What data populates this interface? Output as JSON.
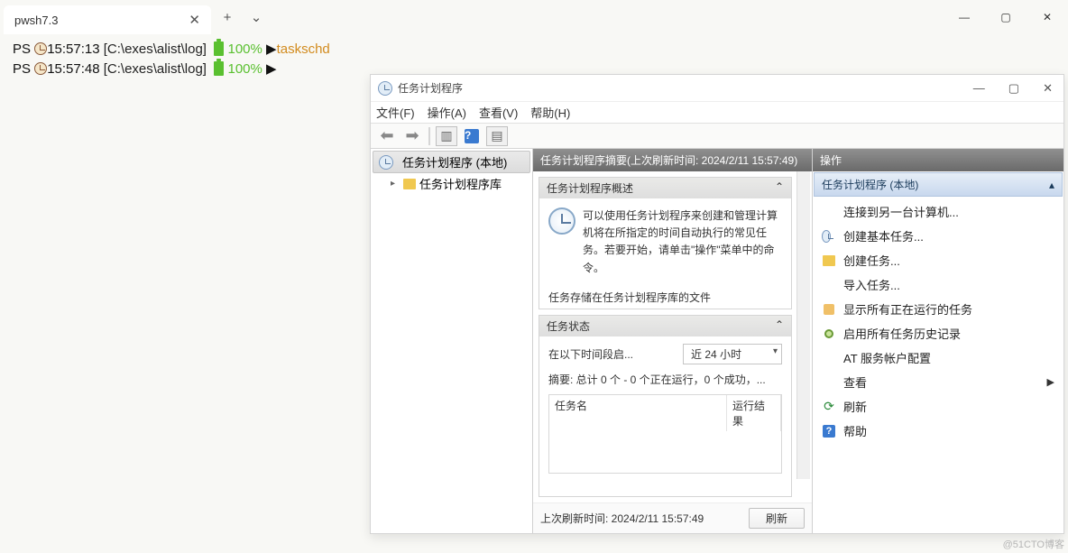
{
  "tab": {
    "title": "pwsh7.3"
  },
  "terminal": {
    "lines": [
      {
        "ps": "PS",
        "time": "15:57:13",
        "path": "[C:\\exes\\alist\\log]",
        "batt": "100%",
        "cmd": "taskschd"
      },
      {
        "ps": "PS",
        "time": "15:57:48",
        "path": "[C:\\exes\\alist\\log]",
        "batt": "100%",
        "cmd": ""
      }
    ]
  },
  "task_scheduler": {
    "title": "任务计划程序",
    "menu": {
      "file": "文件(F)",
      "action": "操作(A)",
      "view": "查看(V)",
      "help": "帮助(H)"
    },
    "tree": {
      "root": "任务计划程序 (本地)",
      "lib": "任务计划程序库"
    },
    "center": {
      "summary_header": "任务计划程序摘要(上次刷新时间: 2024/2/11 15:57:49)",
      "overview_title": "任务计划程序概述",
      "overview_body": "可以使用任务计划程序来创建和管理计算机将在所指定的时间自动执行的常见任务。若要开始，请单击\"操作\"菜单中的命令。",
      "hidden_line": "任务存储在任务计划程序库的文件",
      "status_title": "任务状态",
      "status_label": "在以下时间段启...",
      "status_combo": "近 24 小时",
      "summary_line": "摘要: 总计 0 个 - 0 个正在运行，0 个成功，...",
      "table": {
        "name": "任务名",
        "result": "运行结果"
      },
      "footer_label": "上次刷新时间: 2024/2/11 15:57:49",
      "refresh_btn": "刷新"
    },
    "actions": {
      "header": "操作",
      "section": "任务计划程序 (本地)",
      "items": [
        "连接到另一台计算机...",
        "创建基本任务...",
        "创建任务...",
        "导入任务...",
        "显示所有正在运行的任务",
        "启用所有任务历史记录",
        "AT 服务帐户配置",
        "查看",
        "刷新",
        "帮助"
      ]
    }
  },
  "watermark": "@51CTO博客"
}
